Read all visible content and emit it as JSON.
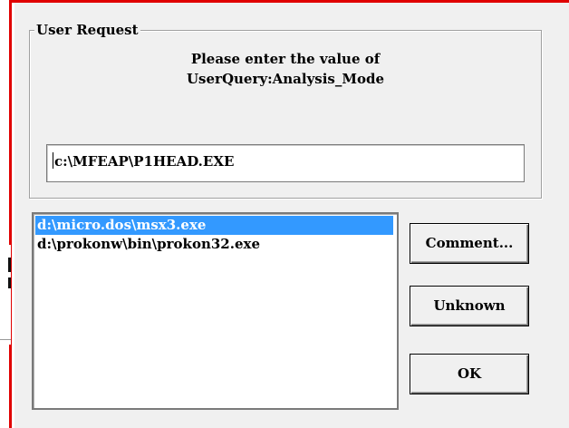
{
  "group": {
    "legend": "User Request",
    "prompt_line1": "Please enter the value of",
    "prompt_line2": "UserQuery:Analysis_Mode"
  },
  "input": {
    "value": "c:\\MFEAP\\P1HEAD.EXE"
  },
  "list": {
    "items": [
      {
        "label": "d:\\micro.dos\\msx3.exe",
        "selected": true
      },
      {
        "label": "d:\\prokonw\\bin\\prokon32.exe",
        "selected": false
      }
    ]
  },
  "buttons": {
    "comment": "Comment...",
    "unknown": "Unknown",
    "ok": "OK"
  },
  "colors": {
    "frame_accent": "#e00000",
    "selection": "#3399ff",
    "dialog_bg": "#f0f0f0"
  }
}
